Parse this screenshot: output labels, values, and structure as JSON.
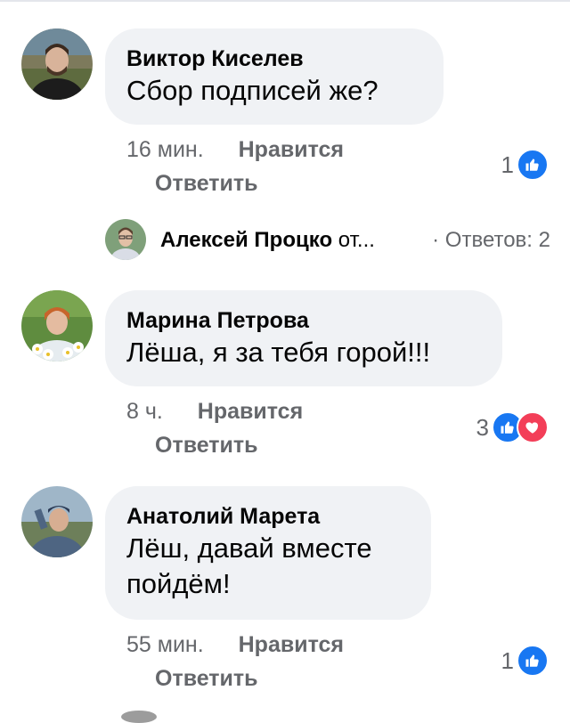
{
  "comments": [
    {
      "author": "Виктор Киселев",
      "text": "Сбор подписей же?",
      "time": "16 мин.",
      "like_label": "Нравится",
      "reply_label": "Ответить",
      "reaction_count": "1",
      "reactions": [
        "like-icon"
      ]
    },
    {
      "author": "Марина Петрова",
      "text": "Лёша, я за тебя горой!!!",
      "time": "8 ч.",
      "like_label": "Нравится",
      "reply_label": "Ответить",
      "reaction_count": "3",
      "reactions": [
        "like-icon",
        "heart-icon"
      ]
    },
    {
      "author": "Анатолий Марета",
      "text": "Лёш, давай вместе пойдём!",
      "time": "55 мин.",
      "like_label": "Нравится",
      "reply_label": "Ответить",
      "reaction_count": "1",
      "reactions": [
        "like-icon"
      ]
    }
  ],
  "replies_preview": {
    "author": "Алексей Процко",
    "action": "от...",
    "separator": "·",
    "count_label": "Ответов: 2"
  },
  "colors": {
    "bubble": "#f0f2f5",
    "secondary_text": "#65676b",
    "like_blue": "#1877f2",
    "love_red": "#f33e58"
  }
}
